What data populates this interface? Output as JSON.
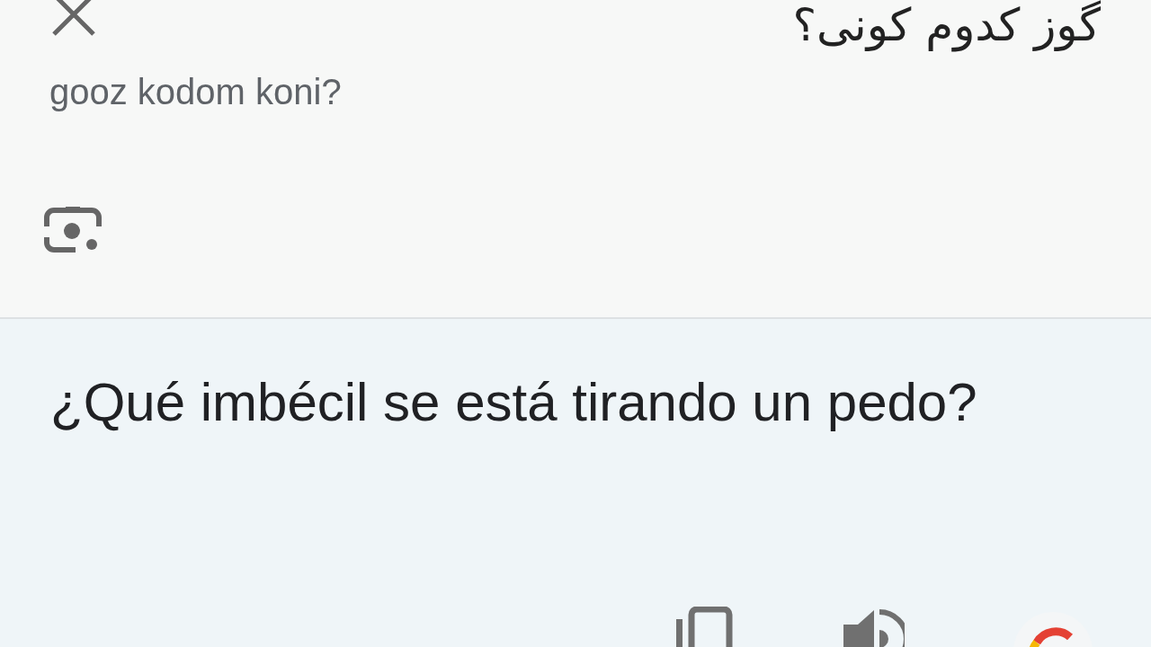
{
  "source": {
    "text": "گوز کدوم کونی؟",
    "transliteration": "gooz kodom koni?"
  },
  "translation": {
    "text": "¿Qué imbécil se está tirando un pedo?"
  }
}
